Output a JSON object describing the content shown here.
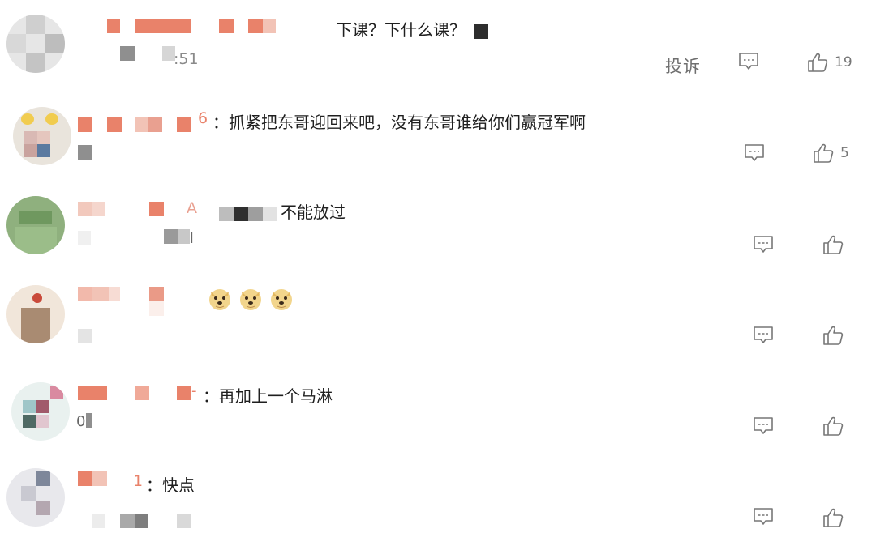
{
  "comments": [
    {
      "tail": "",
      "text": "下课？下什么课？",
      "meta": ":51",
      "report": "投诉",
      "likes": "19"
    },
    {
      "tail": "6",
      "text": "：抓紧把东哥迎回来吧，没有东哥谁给你们赢冠军啊",
      "likes": "5"
    },
    {
      "tail": "A",
      "text": "不能放过",
      "meta": "l"
    },
    {
      "tail": "",
      "text": "",
      "emoji": [
        "doge",
        "doge",
        "doge"
      ]
    },
    {
      "tail": "-",
      "text": "：再加上一个马淋",
      "meta": "0"
    },
    {
      "tail": "1",
      "text": "：快点"
    }
  ],
  "icons": {
    "reply": "comment-bubble-icon",
    "like": "thumbs-up-icon",
    "emoji": "doge-emoji"
  },
  "colors": {
    "name": "#e9826a",
    "name_light": "#f2c3b6",
    "text": "#1f1f1f",
    "muted": "#8a8a8a"
  }
}
